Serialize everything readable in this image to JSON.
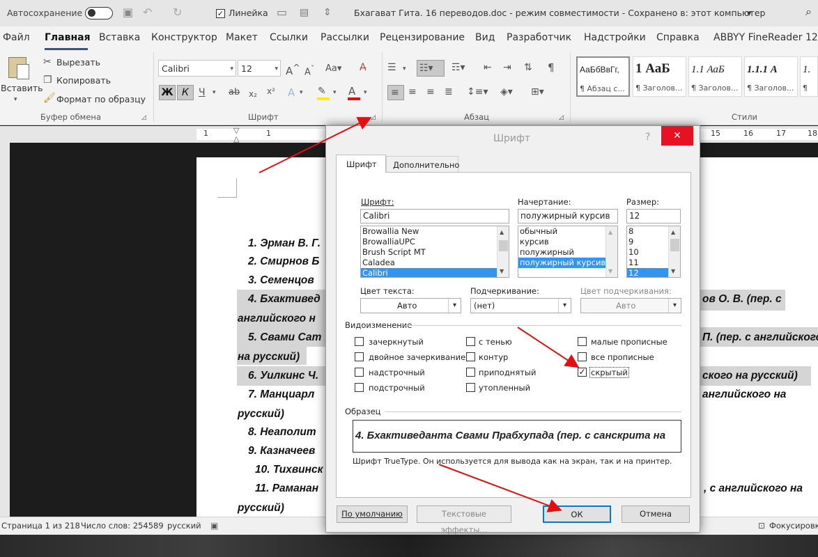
{
  "titlebar": {
    "autosave": "Автосохранение",
    "ruler_toggle": "Линейка",
    "title": "Бхагават Гита. 16 переводов.doc  -  режим совместимости  -  Сохранено в: этот компьютер",
    "title_chevron": "▾"
  },
  "tabs": [
    "Файл",
    "Главная",
    "Вставка",
    "Конструктор",
    "Макет",
    "Ссылки",
    "Рассылки",
    "Рецензирование",
    "Вид",
    "Разработчик",
    "Надстройки",
    "Справка",
    "ABBYY FineReader 12"
  ],
  "ribbon": {
    "clipboard": {
      "paste": "Вставить",
      "cut": "Вырезать",
      "copy": "Копировать",
      "format_painter": "Формат по образцу",
      "group": "Буфер обмена"
    },
    "font": {
      "family": "Calibri",
      "size": "12",
      "bold": "Ж",
      "italic": "К",
      "underline": "Ч",
      "strike": "ab",
      "group": "Шрифт"
    },
    "paragraph": {
      "group": "Абзац"
    },
    "styles": {
      "group": "Стили",
      "items": [
        {
          "preview": "АаБбВвГг,",
          "label": "¶ Абзац с..."
        },
        {
          "preview": "1 АаБ",
          "label": "¶ Заголов..."
        },
        {
          "preview": "1.1 АаБ",
          "label": "¶ Заголов..."
        },
        {
          "preview": "1.1.1 А",
          "label": "¶ Заголов..."
        },
        {
          "preview": "1.",
          "label": "¶"
        }
      ]
    }
  },
  "ruler_numbers": [
    "1",
    "1",
    "15",
    "16",
    "17",
    "18"
  ],
  "document": {
    "lines": [
      "1. Эрман В. Г.",
      "2. Смирнов Б",
      "3. Семенцов",
      "4. Бхактивед",
      "ов О. В. (пер. с",
      "английского  н",
      "5. Свами Сат",
      "П. (пер. с английского",
      "на русский)",
      "6. Уилкинс Ч.",
      "ского  на русский)",
      "7. Манциарл",
      "английского  на",
      "русский)",
      "8. Неаполит",
      "9. Казначеев",
      "10. Тихвинск",
      "11. Раманан",
      ", с английского  на",
      "русский)",
      ")"
    ]
  },
  "statusbar": {
    "page": "Страница 1 из 218",
    "words": "Число слов: 254589",
    "lang": "русский",
    "focus": "Фокусировка"
  },
  "dialog": {
    "title": "Шрифт",
    "help": "?",
    "close": "✕",
    "tabs": [
      "Шрифт",
      "Дополнительно"
    ],
    "font_label": "Шрифт:",
    "font_value": "Calibri",
    "font_list": [
      "Browallia New",
      "BrowalliaUPC",
      "Brush Script MT",
      "Caladea",
      "Calibri"
    ],
    "style_label": "Начертание:",
    "style_value": "полужирный курсив",
    "style_list": [
      "обычный",
      "курсив",
      "полужирный",
      "полужирный курсив"
    ],
    "size_label": "Размер:",
    "size_value": "12",
    "size_list": [
      "8",
      "9",
      "10",
      "11",
      "12"
    ],
    "color_label": "Цвет текста:",
    "color_value": "Авто",
    "underline_label": "Подчеркивание:",
    "underline_value": "(нет)",
    "underline_color_label": "Цвет подчеркивания:",
    "underline_color_value": "Авто",
    "effects_label": "Видоизменение",
    "effects": [
      {
        "label": "зачеркнутый",
        "checked": false
      },
      {
        "label": "двойное зачеркивание",
        "checked": false
      },
      {
        "label": "надстрочный",
        "checked": false
      },
      {
        "label": "подстрочный",
        "checked": false
      },
      {
        "label": "с тенью",
        "checked": false
      },
      {
        "label": "контур",
        "checked": false
      },
      {
        "label": "приподнятый",
        "checked": false
      },
      {
        "label": "утопленный",
        "checked": false
      },
      {
        "label": "малые прописные",
        "checked": false
      },
      {
        "label": "все прописные",
        "checked": false
      },
      {
        "label": "скрытый",
        "checked": true
      }
    ],
    "check_mark": "✓",
    "preview_label": "Образец",
    "preview_text": "4. Бхактиведанта Свами Прабхупада (пер. с санскрита на",
    "font_note": "Шрифт TrueType. Он используется для вывода как на экран, так и на принтер.",
    "btn_default": "По умолчанию",
    "btn_effects": "Текстовые эффекты...",
    "btn_ok": "ОК",
    "btn_cancel": "Отмена"
  },
  "colors": {
    "arrow": "#e01010",
    "accent": "#2b579a",
    "selection": "#3394f1"
  }
}
